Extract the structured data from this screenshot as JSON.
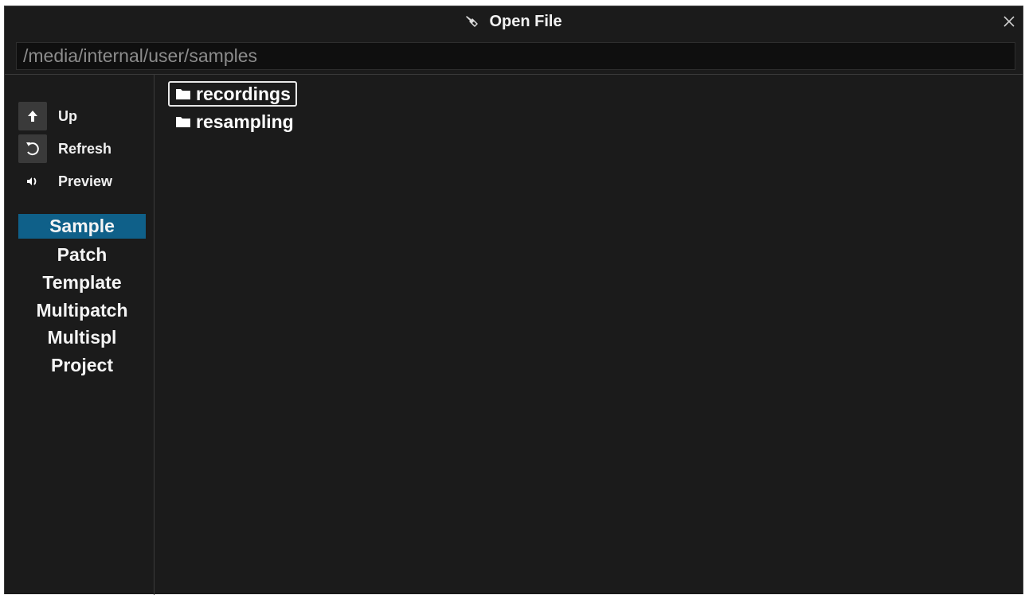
{
  "window": {
    "title": "Open File",
    "title_icon": "hand-pointer-icon",
    "close_icon": "close-icon"
  },
  "path": {
    "value": "/media/internal/user/samples"
  },
  "actions": [
    {
      "label": "Up",
      "icon": "arrow-up-icon"
    },
    {
      "label": "Refresh",
      "icon": "refresh-icon"
    },
    {
      "label": "Preview",
      "icon": "speaker-icon"
    }
  ],
  "file_types": [
    {
      "label": "Sample",
      "selected": true
    },
    {
      "label": "Patch",
      "selected": false
    },
    {
      "label": "Template",
      "selected": false
    },
    {
      "label": "Multipatch",
      "selected": false
    },
    {
      "label": "Multispl",
      "selected": false
    },
    {
      "label": "Project",
      "selected": false
    }
  ],
  "entries": [
    {
      "name": "recordings",
      "type": "folder",
      "focused": true
    },
    {
      "name": "resampling",
      "type": "folder",
      "focused": false
    }
  ],
  "colors": {
    "background": "#1b1b1b",
    "selected": "#0f6089",
    "path_text": "#8c8c8c"
  }
}
